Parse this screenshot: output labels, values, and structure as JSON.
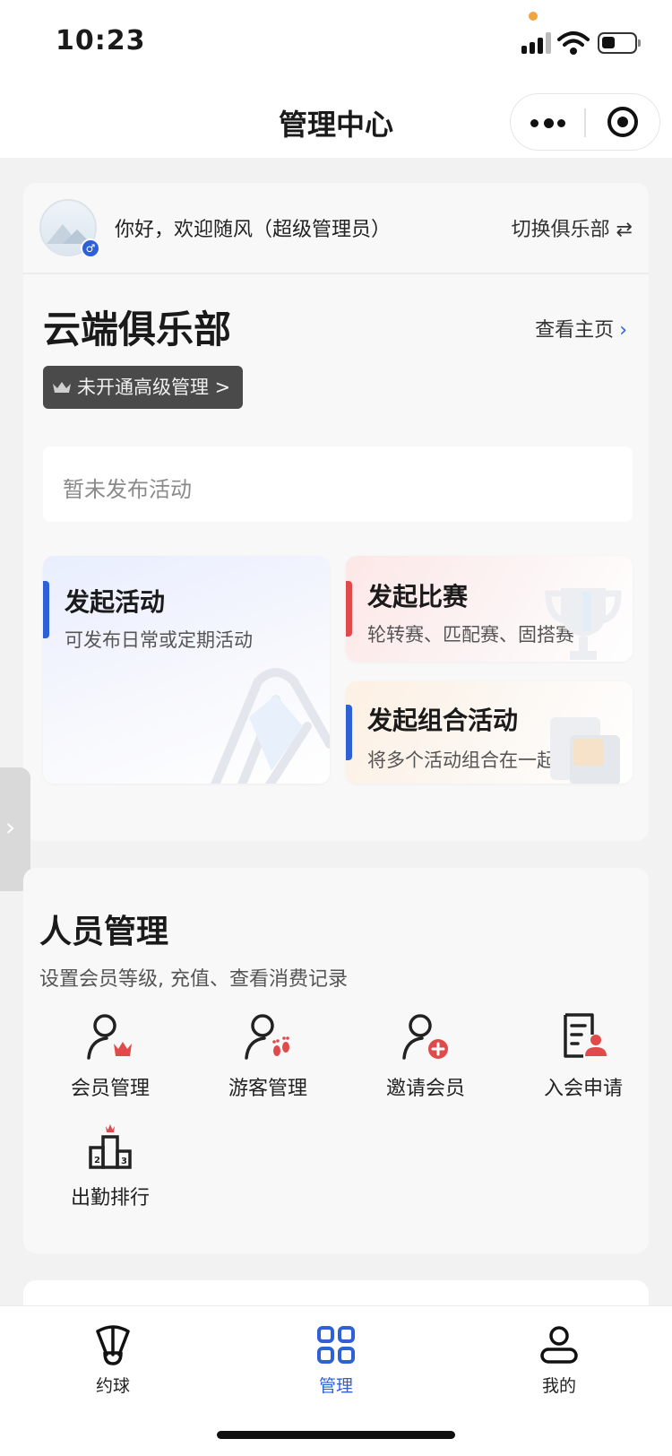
{
  "status_bar": {
    "time": "10:23"
  },
  "nav": {
    "title": "管理中心"
  },
  "club_card": {
    "greeting": "你好，欢迎随风（超级管理员）",
    "switch_club": "切换俱乐部 ⇄",
    "club_name": "云端俱乐部",
    "view_home": "查看主页",
    "premium_badge": "未开通高级管理 >",
    "no_activity": "暂未发布活动",
    "actions": [
      {
        "title": "发起活动",
        "subtitle": "可发布日常或定期活动"
      },
      {
        "title": "发起比赛",
        "subtitle": "轮转赛、匹配赛、固搭赛"
      },
      {
        "title": "发起组合活动",
        "subtitle": "将多个活动组合在一起报名"
      }
    ]
  },
  "member_section": {
    "title": "人员管理",
    "subtitle": "设置会员等级, 充值、查看消费记录",
    "features": [
      {
        "label": "会员管理",
        "icon": "member-crown-icon"
      },
      {
        "label": "游客管理",
        "icon": "guest-footprint-icon"
      },
      {
        "label": "邀请会员",
        "icon": "invite-member-icon"
      },
      {
        "label": "入会申请",
        "icon": "application-form-icon"
      },
      {
        "label": "出勤排行",
        "icon": "podium-ranking-icon"
      }
    ]
  },
  "tabbar": {
    "items": [
      {
        "label": "约球",
        "icon": "shuttlecock-icon"
      },
      {
        "label": "管理",
        "icon": "grid-icon"
      },
      {
        "label": "我的",
        "icon": "user-icon"
      }
    ]
  },
  "colors": {
    "accent": "#2f61d6",
    "red": "#e04a4a",
    "dark_badge": "#4a4a4a"
  }
}
